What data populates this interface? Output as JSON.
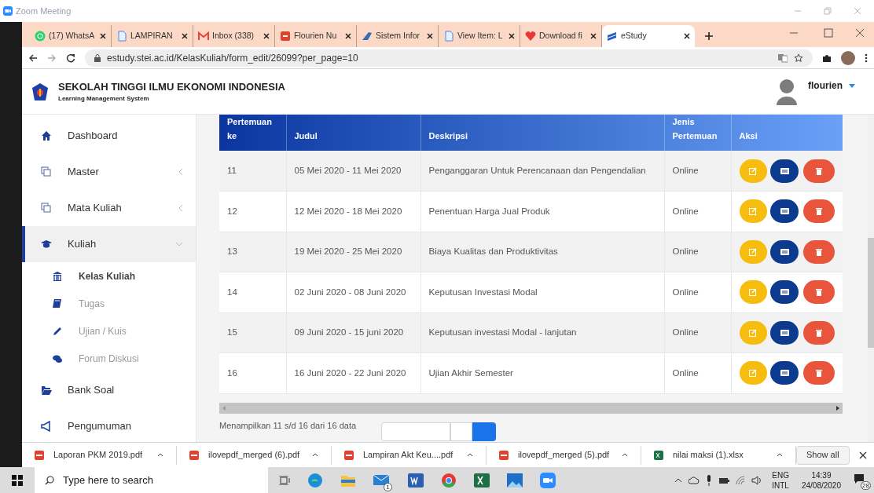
{
  "zoom_window": {
    "title": "Zoom Meeting"
  },
  "browser": {
    "tabs": [
      {
        "label": "(17) WhatsA",
        "kind": "chat",
        "selected": false
      },
      {
        "label": "LAMPIRAN",
        "kind": "doc",
        "selected": false
      },
      {
        "label": "Inbox (338)",
        "kind": "mail",
        "selected": false
      },
      {
        "label": "Flourien Nu",
        "kind": "pdf",
        "selected": false
      },
      {
        "label": "Sistem Infor",
        "kind": "wing",
        "selected": false
      },
      {
        "label": "View Item: L",
        "kind": "doc",
        "selected": false
      },
      {
        "label": "Download fi",
        "kind": "heart",
        "selected": false
      },
      {
        "label": "eStudy",
        "kind": "books",
        "selected": true
      }
    ],
    "url": "estudy.stei.ac.id/KelasKuliah/form_edit/26099?per_page=10"
  },
  "site": {
    "title": "SEKOLAH TINGGI ILMU EKONOMI INDONESIA",
    "subtitle": "Learning Management System",
    "user": "flourien"
  },
  "sidebar": {
    "items": [
      {
        "label": "Dashboard",
        "kind": "link",
        "selected": false
      },
      {
        "label": "Master",
        "kind": "menu",
        "selected": false,
        "expanded": false
      },
      {
        "label": "Mata Kuliah",
        "kind": "menu",
        "selected": false,
        "expanded": false
      },
      {
        "label": "Kuliah",
        "kind": "menu",
        "selected": true,
        "expanded": true,
        "children": [
          {
            "label": "Kelas Kuliah",
            "selected": true
          },
          {
            "label": "Tugas",
            "selected": false
          },
          {
            "label": "Ujian / Kuis",
            "selected": false
          },
          {
            "label": "Forum Diskusi",
            "selected": false
          }
        ]
      },
      {
        "label": "Bank Soal",
        "kind": "link",
        "selected": false
      },
      {
        "label": "Pengumuman",
        "kind": "link",
        "selected": false
      }
    ]
  },
  "table": {
    "columns": [
      "Pertemuan ke",
      "Judul",
      "Deskripsi",
      "Jenis Pertemuan",
      "Aksi"
    ],
    "rows": [
      {
        "no": "11",
        "title": "05 Mei 2020 - 11 Mei 2020",
        "description": "Penganggaran Untuk Perencanaan dan Pengendalian",
        "type": "Online"
      },
      {
        "no": "12",
        "title": "12 Mei 2020 - 18 Mei 2020",
        "description": "Penentuan Harga Jual Produk",
        "type": "Online"
      },
      {
        "no": "13",
        "title": "19 Mei 2020 - 25 Mei 2020",
        "description": "Biaya Kualitas dan Produktivitas",
        "type": "Online"
      },
      {
        "no": "14",
        "title": "02 Juni 2020 - 08 Juni 2020",
        "description": "Keputusan Investasi Modal",
        "type": "Online"
      },
      {
        "no": "15",
        "title": "09 Juni 2020 - 15 juni 2020",
        "description": "Keputusan investasi Modal - lanjutan",
        "type": "Online"
      },
      {
        "no": "16",
        "title": "16 Juni 2020 - 22 Juni 2020",
        "description": "Ujian Akhir Semester",
        "type": "Online"
      }
    ],
    "footer": "Menampilkan 11 s/d 16 dari 16 data"
  },
  "downloads": {
    "items": [
      {
        "name": "Laporan PKM 2019.pdf",
        "kind": "pdf"
      },
      {
        "name": "ilovepdf_merged (6).pdf",
        "kind": "pdf"
      },
      {
        "name": "Lampiran Akt Keu....pdf",
        "kind": "pdf"
      },
      {
        "name": "ilovepdf_merged (5).pdf",
        "kind": "pdf"
      },
      {
        "name": "nilai maksi (1).xlsx",
        "kind": "xlsx"
      }
    ],
    "show_all": "Show all"
  },
  "taskbar": {
    "search_placeholder": "Type here to search",
    "mail_badge": "1",
    "language": "ENG",
    "layout": "INTL",
    "time": "14:39",
    "date": "24/08/2020",
    "notifications": "28"
  }
}
